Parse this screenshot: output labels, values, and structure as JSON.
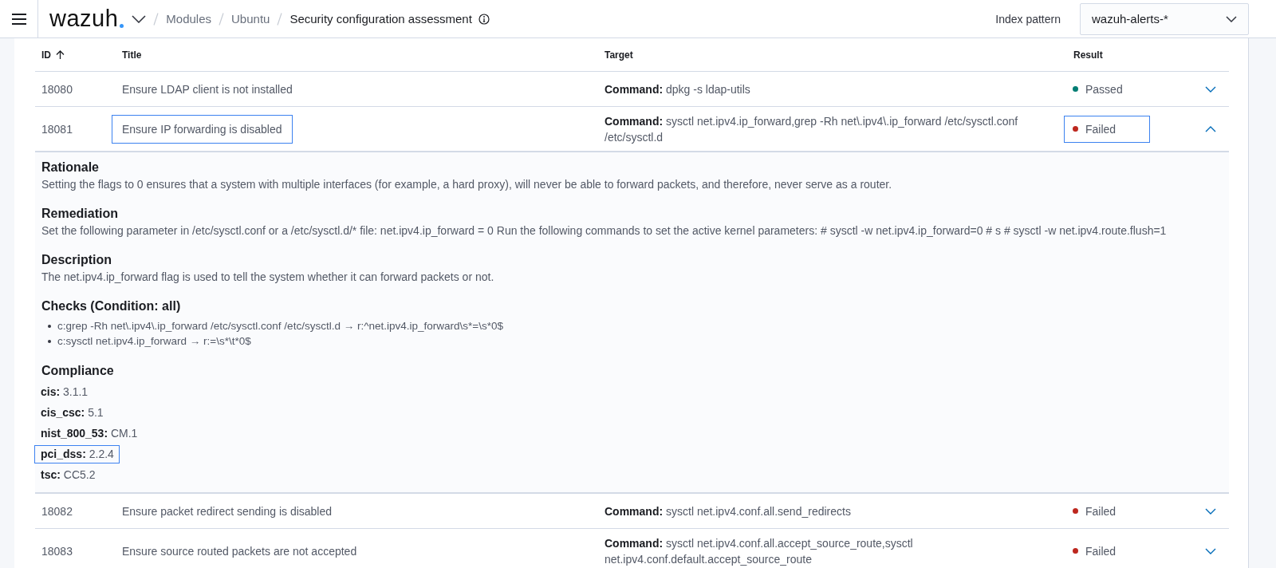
{
  "header": {
    "logo": "wazuh",
    "breadcrumbs": [
      {
        "label": "Modules",
        "current": false
      },
      {
        "label": "Ubuntu",
        "current": false
      },
      {
        "label": "Security configuration assessment",
        "current": true
      }
    ],
    "index_pattern": {
      "label": "Index pattern",
      "value": "wazuh-alerts-*"
    }
  },
  "table": {
    "columns": [
      {
        "label": "ID",
        "sorted": true
      },
      {
        "label": "Title",
        "sorted": false
      },
      {
        "label": "Target",
        "sorted": false
      },
      {
        "label": "Result",
        "sorted": false
      }
    ],
    "rows": [
      {
        "id": "18080",
        "title": "Ensure LDAP client is not installed",
        "title_highlighted": false,
        "target_label": "Command:",
        "target": "dpkg -s ldap-utils",
        "result": "Passed",
        "color": "#017d73",
        "result_highlighted": false,
        "expanded": false
      },
      {
        "id": "18081",
        "title": "Ensure IP forwarding is disabled",
        "title_highlighted": true,
        "target_label": "Command:",
        "target": "sysctl net.ipv4.ip_forward,grep -Rh net\\.ipv4\\.ip_forward /etc/sysctl.conf /etc/sysctl.d",
        "result": "Failed",
        "color": "#bd271e",
        "result_highlighted": true,
        "expanded": true,
        "details": [
          {
            "kind": "text",
            "heading": "Rationale",
            "text": "Setting the flags to 0 ensures that a system with multiple interfaces (for example, a hard proxy), will never be able to forward packets, and therefore, never serve as a router."
          },
          {
            "kind": "text",
            "heading": "Remediation",
            "text": "Set the following parameter in /etc/sysctl.conf or a /etc/sysctl.d/* file: net.ipv4.ip_forward = 0 Run the following commands to set the active kernel parameters: # sysctl -w net.ipv4.ip_forward=0 # s # sysctl -w net.ipv4.route.flush=1"
          },
          {
            "kind": "text",
            "heading": "Description",
            "text": "The net.ipv4.ip_forward flag is used to tell the system whether it can forward packets or not."
          },
          {
            "kind": "list",
            "heading": "Checks (Condition: all)",
            "items": [
              "c:grep -Rh net\\.ipv4\\.ip_forward /etc/sysctl.conf /etc/sysctl.d → r:^net.ipv4.ip_forward\\s*=\\s*0$",
              "c:sysctl net.ipv4.ip_forward → r:=\\s*\\t*0$"
            ]
          },
          {
            "kind": "pairs",
            "heading": "Compliance",
            "items": [
              {
                "key": "cis:",
                "value": "3.1.1",
                "highlighted": false
              },
              {
                "key": "cis_csc:",
                "value": "5.1",
                "highlighted": false
              },
              {
                "key": "nist_800_53:",
                "value": "CM.1",
                "highlighted": false
              },
              {
                "key": "pci_dss:",
                "value": "2.2.4",
                "highlighted": true
              },
              {
                "key": "tsc:",
                "value": "CC5.2",
                "highlighted": false
              }
            ]
          }
        ]
      },
      {
        "id": "18082",
        "title": "Ensure packet redirect sending is disabled",
        "title_highlighted": false,
        "target_label": "Command:",
        "target": "sysctl net.ipv4.conf.all.send_redirects",
        "result": "Failed",
        "color": "#bd271e",
        "result_highlighted": false,
        "expanded": false
      },
      {
        "id": "18083",
        "title": "Ensure source routed packets are not accepted",
        "title_highlighted": false,
        "target_label": "Command:",
        "target": "sysctl net.ipv4.conf.all.accept_source_route,sysctl net.ipv4.conf.default.accept_source_route",
        "result": "Failed",
        "color": "#bd271e",
        "result_highlighted": false,
        "expanded": false
      }
    ]
  }
}
